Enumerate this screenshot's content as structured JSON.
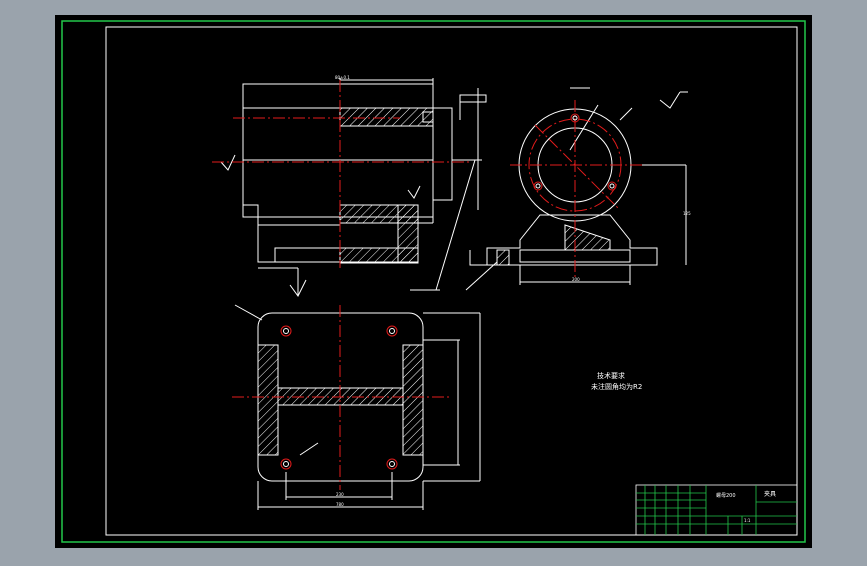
{
  "colors": {
    "workspace_bg": "#9aa3ac",
    "canvas_bg": "#000000",
    "frame": "#22c74a",
    "line": "#ffffff",
    "center_line": "#e21b1b",
    "hatch": "#ffffff"
  },
  "notes": {
    "line1": "技术要求",
    "line2": "未注圆角均为R2"
  },
  "title_block": {
    "drawing_name": "螺母200",
    "material": "夹具",
    "scale": "1:1"
  },
  "dims": {
    "top_width": "80±0.1",
    "side_height": "125",
    "front_width": "200",
    "plan_width": "230",
    "plan_bottom": "780"
  }
}
